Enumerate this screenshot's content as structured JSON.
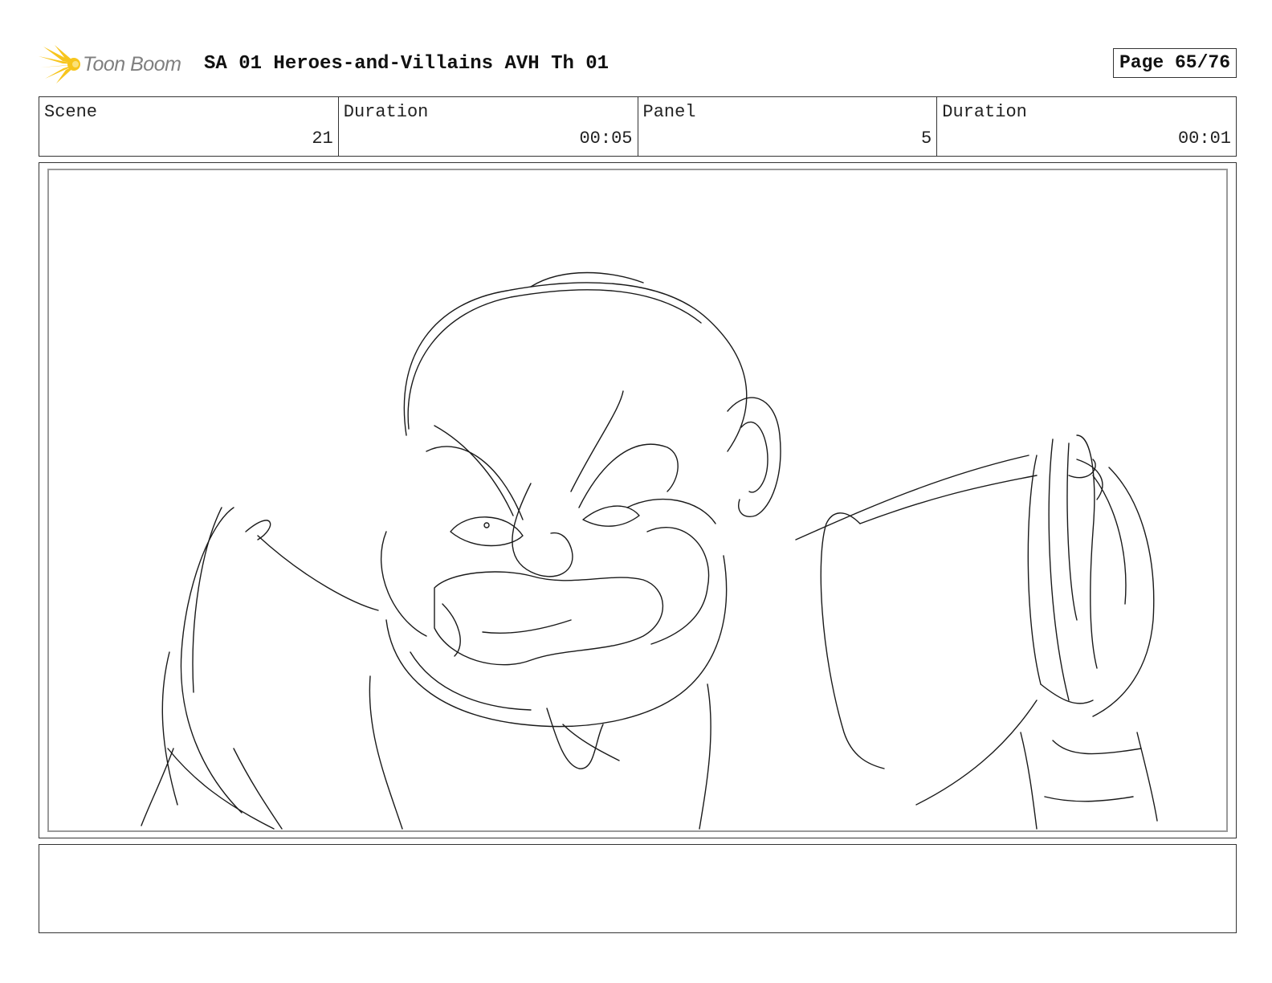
{
  "brand": {
    "logo_text": "Toon Boom",
    "accent": "#f7c51d"
  },
  "header": {
    "title": "SA 01 Heroes-and-Villains AVH Th 01",
    "page": "Page 65/76"
  },
  "info": [
    {
      "label": "Scene",
      "value": "21"
    },
    {
      "label": "Duration",
      "value": "00:05"
    },
    {
      "label": "Panel",
      "value": "5"
    },
    {
      "label": "Duration",
      "value": "00:01"
    }
  ],
  "notes": {
    "text": ""
  }
}
